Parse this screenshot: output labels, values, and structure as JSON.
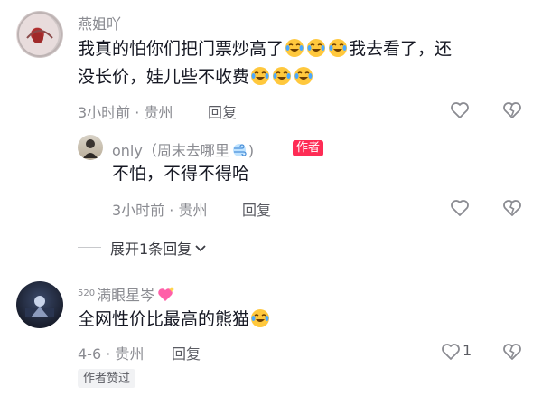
{
  "comments": [
    {
      "username": "燕姐吖",
      "text_parts": [
        "我真的怕你们把门票炒高了",
        "[emoji-laugh-cry]",
        "[emoji-laugh-cry]",
        "[emoji-laugh-cry]",
        "我去看了，还没长价，娃儿些不收费",
        "[emoji-laugh-cry]",
        "[emoji-laugh-cry]",
        "[emoji-laugh-cry]"
      ],
      "line1": "我真的怕你们把门票炒高了",
      "line1_after": "我去看了，还",
      "line2": "没长价，娃儿些不收费",
      "time_location": "3小时前 · 贵州",
      "reply_label": "回复"
    },
    {
      "username": "only（周末去哪里",
      "author_badge": "作者",
      "text": "不怕，不得不得哈",
      "time_location": "3小时前 · 贵州",
      "reply_label": "回复"
    },
    {
      "username_prefix": "520",
      "username": "满眼星岑",
      "text": "全网性价比最高的熊猫",
      "time_location": "4-6 · 贵州",
      "reply_label": "回复",
      "like_count": "1",
      "liked_tag": "作者赞过"
    }
  ],
  "expand_replies": "展开1条回复",
  "icons": {
    "like": "heart-outline-icon",
    "dislike": "broken-heart-icon",
    "emoji": "laugh-cry-emoji",
    "expand": "chevron-down-icon"
  },
  "colors": {
    "name": "#8a8b91",
    "text": "#161823",
    "author_badge": "#fe2c55",
    "tag_bg": "#f1f2f4"
  }
}
